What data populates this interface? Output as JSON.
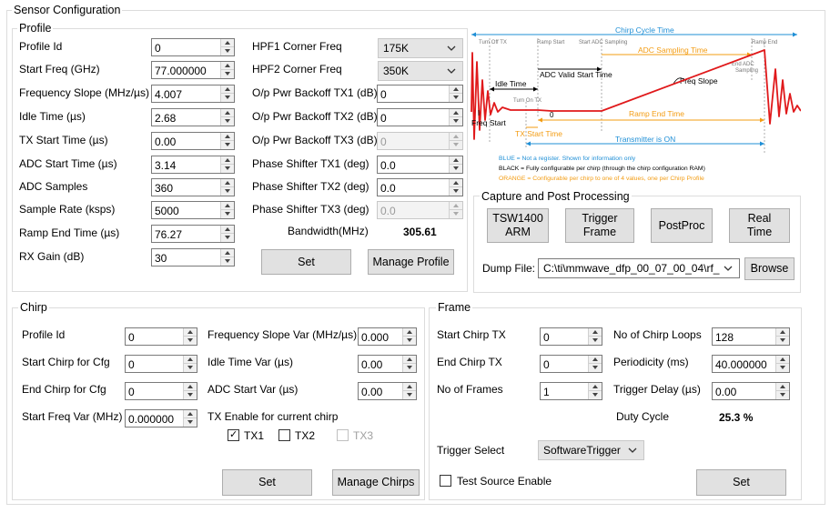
{
  "sensor_config": {
    "title": "Sensor Configuration"
  },
  "profile": {
    "title": "Profile",
    "fields": [
      {
        "label": "Profile Id",
        "value": "0"
      },
      {
        "label": "Start Freq (GHz)",
        "value": "77.000000"
      },
      {
        "label": "Frequency Slope (MHz/µs)",
        "value": "4.007"
      },
      {
        "label": "Idle Time (µs)",
        "value": "2.68"
      },
      {
        "label": "TX Start Time (µs)",
        "value": "0.00"
      },
      {
        "label": "ADC Start Time (µs)",
        "value": "3.14"
      },
      {
        "label": "ADC Samples",
        "value": "360"
      },
      {
        "label": "Sample Rate (ksps)",
        "value": "5000"
      },
      {
        "label": "Ramp End Time (µs)",
        "value": "76.27"
      },
      {
        "label": "RX Gain (dB)",
        "value": "30"
      }
    ],
    "hpf1": {
      "label": "HPF1 Corner Freq",
      "value": "175K"
    },
    "hpf2": {
      "label": "HPF2 Corner Freq",
      "value": "350K"
    },
    "right_fields": [
      {
        "label": "O/p Pwr Backoff TX1 (dB)",
        "value": "0",
        "disabled": false
      },
      {
        "label": "O/p Pwr Backoff TX2 (dB)",
        "value": "0",
        "disabled": false
      },
      {
        "label": "O/p Pwr Backoff TX3 (dB)",
        "value": "0",
        "disabled": true
      },
      {
        "label": "Phase Shifter TX1 (deg)",
        "value": "0.0",
        "disabled": false
      },
      {
        "label": "Phase Shifter TX2 (deg)",
        "value": "0.0",
        "disabled": false
      },
      {
        "label": "Phase Shifter TX3 (deg)",
        "value": "0.0",
        "disabled": true
      }
    ],
    "bandwidth_label": "Bandwidth(MHz)",
    "bandwidth_value": "305.61",
    "set_label": "Set",
    "manage_label": "Manage Profile"
  },
  "diagram": {
    "chirp_cycle_time": "Chirp Cycle Time",
    "turn_off_tx": "Turn Off TX",
    "ramp_start": "Ramp Start",
    "start_adc_sampling": "Start ADC Sampling",
    "adc_sampling_time": "ADC Sampling Time",
    "ramp_end": "Ramp End",
    "end_adc_sampling_1": "End ADC",
    "end_adc_sampling_2": "Sampling",
    "adc_valid_start_time": "ADC Valid Start Time",
    "idle_time": "Idle Time",
    "freq_slope": "Freq Slope",
    "turn_on_tx": "Turn On TX",
    "zero": "0",
    "freq_start": "Freq Start",
    "ramp_end_time": "Ramp End Time",
    "tx_start_time": "TX Start Time",
    "transmitter_on": "Transmitter is ON",
    "legend_blue": "BLUE = Not a register. Shown for information only",
    "legend_black": "BLACK = Fully configurable per chirp (through the chirp configuration RAM)",
    "legend_orange": "ORANGE = Configurable per chirp to one of 4 values, one per Chirp Profile",
    "colors": {
      "blue": "#1f8fd6",
      "orange": "#f39c12",
      "red": "#e0191b"
    }
  },
  "capture": {
    "title": "Capture and Post Processing",
    "buttons": [
      "TSW1400\nARM",
      "Trigger\nFrame",
      "PostProc",
      "Real\nTime"
    ],
    "dump_label": "Dump File:",
    "dump_value": "C:\\ti\\mmwave_dfp_00_07_00_04\\rf_",
    "browse_label": "Browse"
  },
  "chirp": {
    "title": "Chirp",
    "left_fields": [
      {
        "label": "Profile Id",
        "value": "0"
      },
      {
        "label": "Start Chirp for Cfg",
        "value": "0"
      },
      {
        "label": "End Chirp for Cfg",
        "value": "0"
      },
      {
        "label": "Start Freq Var (MHz)",
        "value": "0.000000"
      }
    ],
    "right_fields": [
      {
        "label": "Frequency Slope Var (MHz/µs)",
        "value": "0.000"
      },
      {
        "label": "Idle Time Var (µs)",
        "value": "0.00"
      },
      {
        "label": "ADC Start Var (µs)",
        "value": "0.00"
      }
    ],
    "tx_enable_label": "TX Enable for current chirp",
    "tx": [
      {
        "label": "TX1",
        "checked": true,
        "disabled": false
      },
      {
        "label": "TX2",
        "checked": false,
        "disabled": false
      },
      {
        "label": "TX3",
        "checked": false,
        "disabled": true
      }
    ],
    "set_label": "Set",
    "manage_label": "Manage Chirps"
  },
  "frame": {
    "title": "Frame",
    "left_fields": [
      {
        "label": "Start Chirp TX",
        "value": "0"
      },
      {
        "label": "End Chirp TX",
        "value": "0"
      },
      {
        "label": "No of Frames",
        "value": "1"
      }
    ],
    "right_fields": [
      {
        "label": "No of Chirp Loops",
        "value": "128"
      },
      {
        "label": "Periodicity (ms)",
        "value": "40.000000"
      },
      {
        "label": "Trigger Delay (µs)",
        "value": "0.00"
      }
    ],
    "duty_cycle_label": "Duty Cycle",
    "duty_cycle_value": "25.3 %",
    "trigger_select_label": "Trigger Select",
    "trigger_select_value": "SoftwareTrigger",
    "test_source_label": "Test Source Enable",
    "test_source_checked": false,
    "set_label": "Set"
  }
}
